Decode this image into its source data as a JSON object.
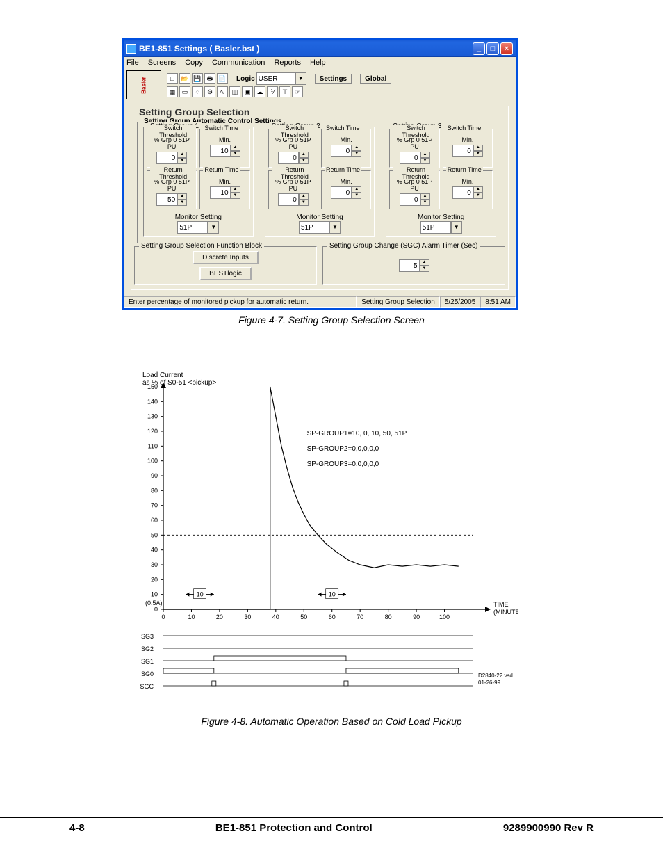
{
  "window": {
    "title": "BE1-851 Settings   ( Basler.bst )",
    "menus": {
      "file": "File",
      "screens": "Screens",
      "copy": "Copy",
      "communication": "Communication",
      "reports": "Reports",
      "help": "Help"
    },
    "toolbar": {
      "logic_label": "Logic",
      "logic_value": "USER",
      "settings_btn": "Settings",
      "global_btn": "Global"
    }
  },
  "content": {
    "main_title": "Setting Group Selection",
    "auto_title": "Setting Group Automatic Control Settings",
    "groups": [
      {
        "title": "Setting Group 1",
        "switch_th": "0",
        "switch_time": "10",
        "return_th": "50",
        "return_time": "10",
        "monitor": "51P"
      },
      {
        "title": "Setting Group 2",
        "switch_th": "0",
        "switch_time": "0",
        "return_th": "0",
        "return_time": "0",
        "monitor": "51P"
      },
      {
        "title": "Setting Group 3",
        "switch_th": "0",
        "switch_time": "0",
        "return_th": "0",
        "return_time": "0",
        "monitor": "51P"
      }
    ],
    "labels": {
      "switch_threshold": "Switch Threshold",
      "switch_time": "Switch Time",
      "return_threshold": "Return Threshold",
      "return_time": "Return Time",
      "pct_unit": "% Grp 0 51P PU",
      "min_unit": "Min.",
      "monitor_setting": "Monitor Setting"
    },
    "funcblock": {
      "title": "Setting Group Selection Function Block",
      "btn1": "Discrete Inputs",
      "btn2": "BESTlogic"
    },
    "sgc": {
      "title": "Setting Group Change (SGC) Alarm Timer (Sec)",
      "value": "5"
    }
  },
  "statusbar": {
    "msg": "Enter percentage of monitored pickup for automatic return.",
    "mode": "Setting Group Selection",
    "date": "5/25/2005",
    "time": "8:51 AM"
  },
  "captions": {
    "fig47": "Figure 4-7. Setting Group Selection Screen",
    "fig48": "Figure 4-8. Automatic Operation Based on Cold Load Pickup"
  },
  "footer": {
    "page": "4-8",
    "center": "BE1-851 Protection and Control",
    "right": "9289900990 Rev R"
  },
  "chart_data": {
    "type": "line",
    "title": "Load Current\nas % of S0-51 <pickup>",
    "ylabel": "",
    "xlabel": "TIME\n(MINUTES)",
    "ylim": [
      0,
      150
    ],
    "xlim": [
      0,
      110
    ],
    "y_ticks": [
      0,
      10,
      20,
      30,
      40,
      50,
      60,
      70,
      80,
      90,
      100,
      110,
      120,
      130,
      140,
      150
    ],
    "x_ticks": [
      0,
      10,
      20,
      30,
      40,
      50,
      60,
      70,
      80,
      90,
      100
    ],
    "annotations": [
      "SP-GROUP1=10, 0, 10, 50, 51P",
      "SP-GROUP2=0,0,0,0,0",
      "SP-GROUP3=0,0,0,0,0"
    ],
    "reference_y": 50,
    "origin_label": "(0.5A)",
    "curve": [
      {
        "x": 0,
        "y": 0
      },
      {
        "x": 38,
        "y": 0
      },
      {
        "x": 38,
        "y": 150
      },
      {
        "x": 40,
        "y": 130
      },
      {
        "x": 42,
        "y": 110
      },
      {
        "x": 44,
        "y": 95
      },
      {
        "x": 46,
        "y": 82
      },
      {
        "x": 48,
        "y": 72
      },
      {
        "x": 50,
        "y": 64
      },
      {
        "x": 52,
        "y": 57
      },
      {
        "x": 55,
        "y": 50
      },
      {
        "x": 58,
        "y": 44
      },
      {
        "x": 62,
        "y": 38
      },
      {
        "x": 66,
        "y": 33
      },
      {
        "x": 70,
        "y": 30
      },
      {
        "x": 75,
        "y": 28
      },
      {
        "x": 80,
        "y": 30
      },
      {
        "x": 85,
        "y": 29
      },
      {
        "x": 90,
        "y": 30
      },
      {
        "x": 95,
        "y": 29
      },
      {
        "x": 100,
        "y": 30
      },
      {
        "x": 105,
        "y": 29
      }
    ],
    "gantt_tracks": [
      "SG3",
      "SG2",
      "SG1",
      "SG0",
      "SGC"
    ],
    "gantt_bars": [
      {
        "track": "SG1",
        "start": 18,
        "end": 65
      },
      {
        "track": "SG0",
        "start": 0,
        "end": 18
      },
      {
        "track": "SG0",
        "start": 65,
        "end": 105
      }
    ],
    "gantt_ticks": [
      {
        "track": "SGC",
        "x": 18
      },
      {
        "track": "SGC",
        "x": 65
      }
    ],
    "range_arrows": [
      {
        "x1": 8,
        "x2": 18,
        "y": 10,
        "label": "10"
      },
      {
        "x1": 55,
        "x2": 65,
        "y": 10,
        "label": "10"
      }
    ],
    "diagram_ref": "D2840-22.vsd\n01-26-99"
  }
}
